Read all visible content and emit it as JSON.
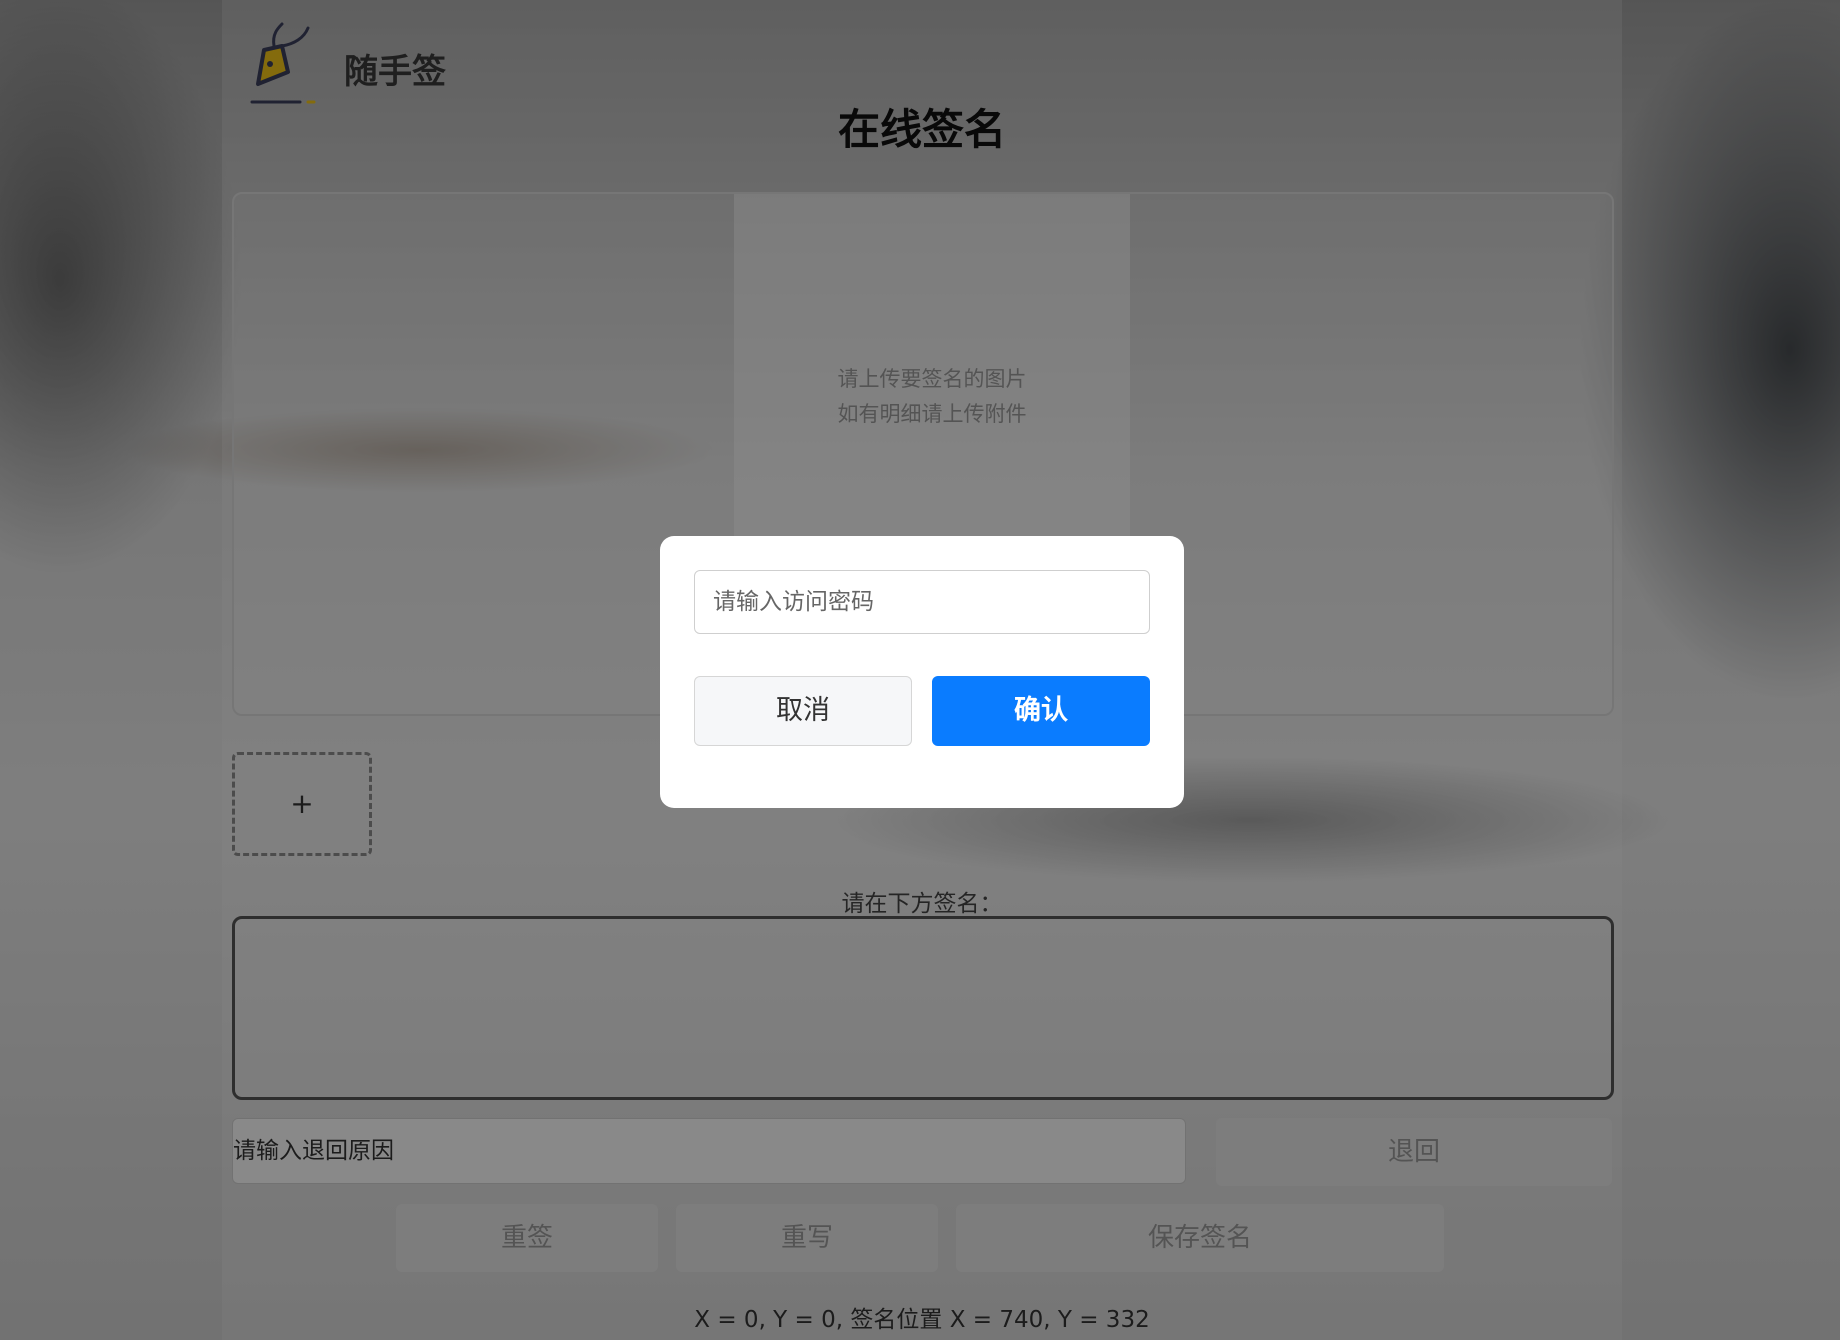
{
  "app": {
    "brand_name": "随手签"
  },
  "page": {
    "title": "在线签名"
  },
  "upload": {
    "hint_line1": "请上传要签名的图片",
    "hint_line2": "如有明细请上传附件",
    "add_symbol": "+"
  },
  "signature": {
    "label": "请在下方签名："
  },
  "return_section": {
    "reason_placeholder": "请输入退回原因",
    "return_label": "退回"
  },
  "actions": {
    "resign_label": "重签",
    "rewrite_label": "重写",
    "save_label": "保存签名"
  },
  "status": {
    "coordinates": "X = 0, Y = 0, 签名位置 X = 740, Y = 332"
  },
  "modal": {
    "password_placeholder": "请输入访问密码",
    "cancel_label": "取消",
    "confirm_label": "确认"
  },
  "colors": {
    "primary": "#0a7cff",
    "logo_accent": "#f0c419",
    "logo_stroke": "#3b3f5c"
  }
}
